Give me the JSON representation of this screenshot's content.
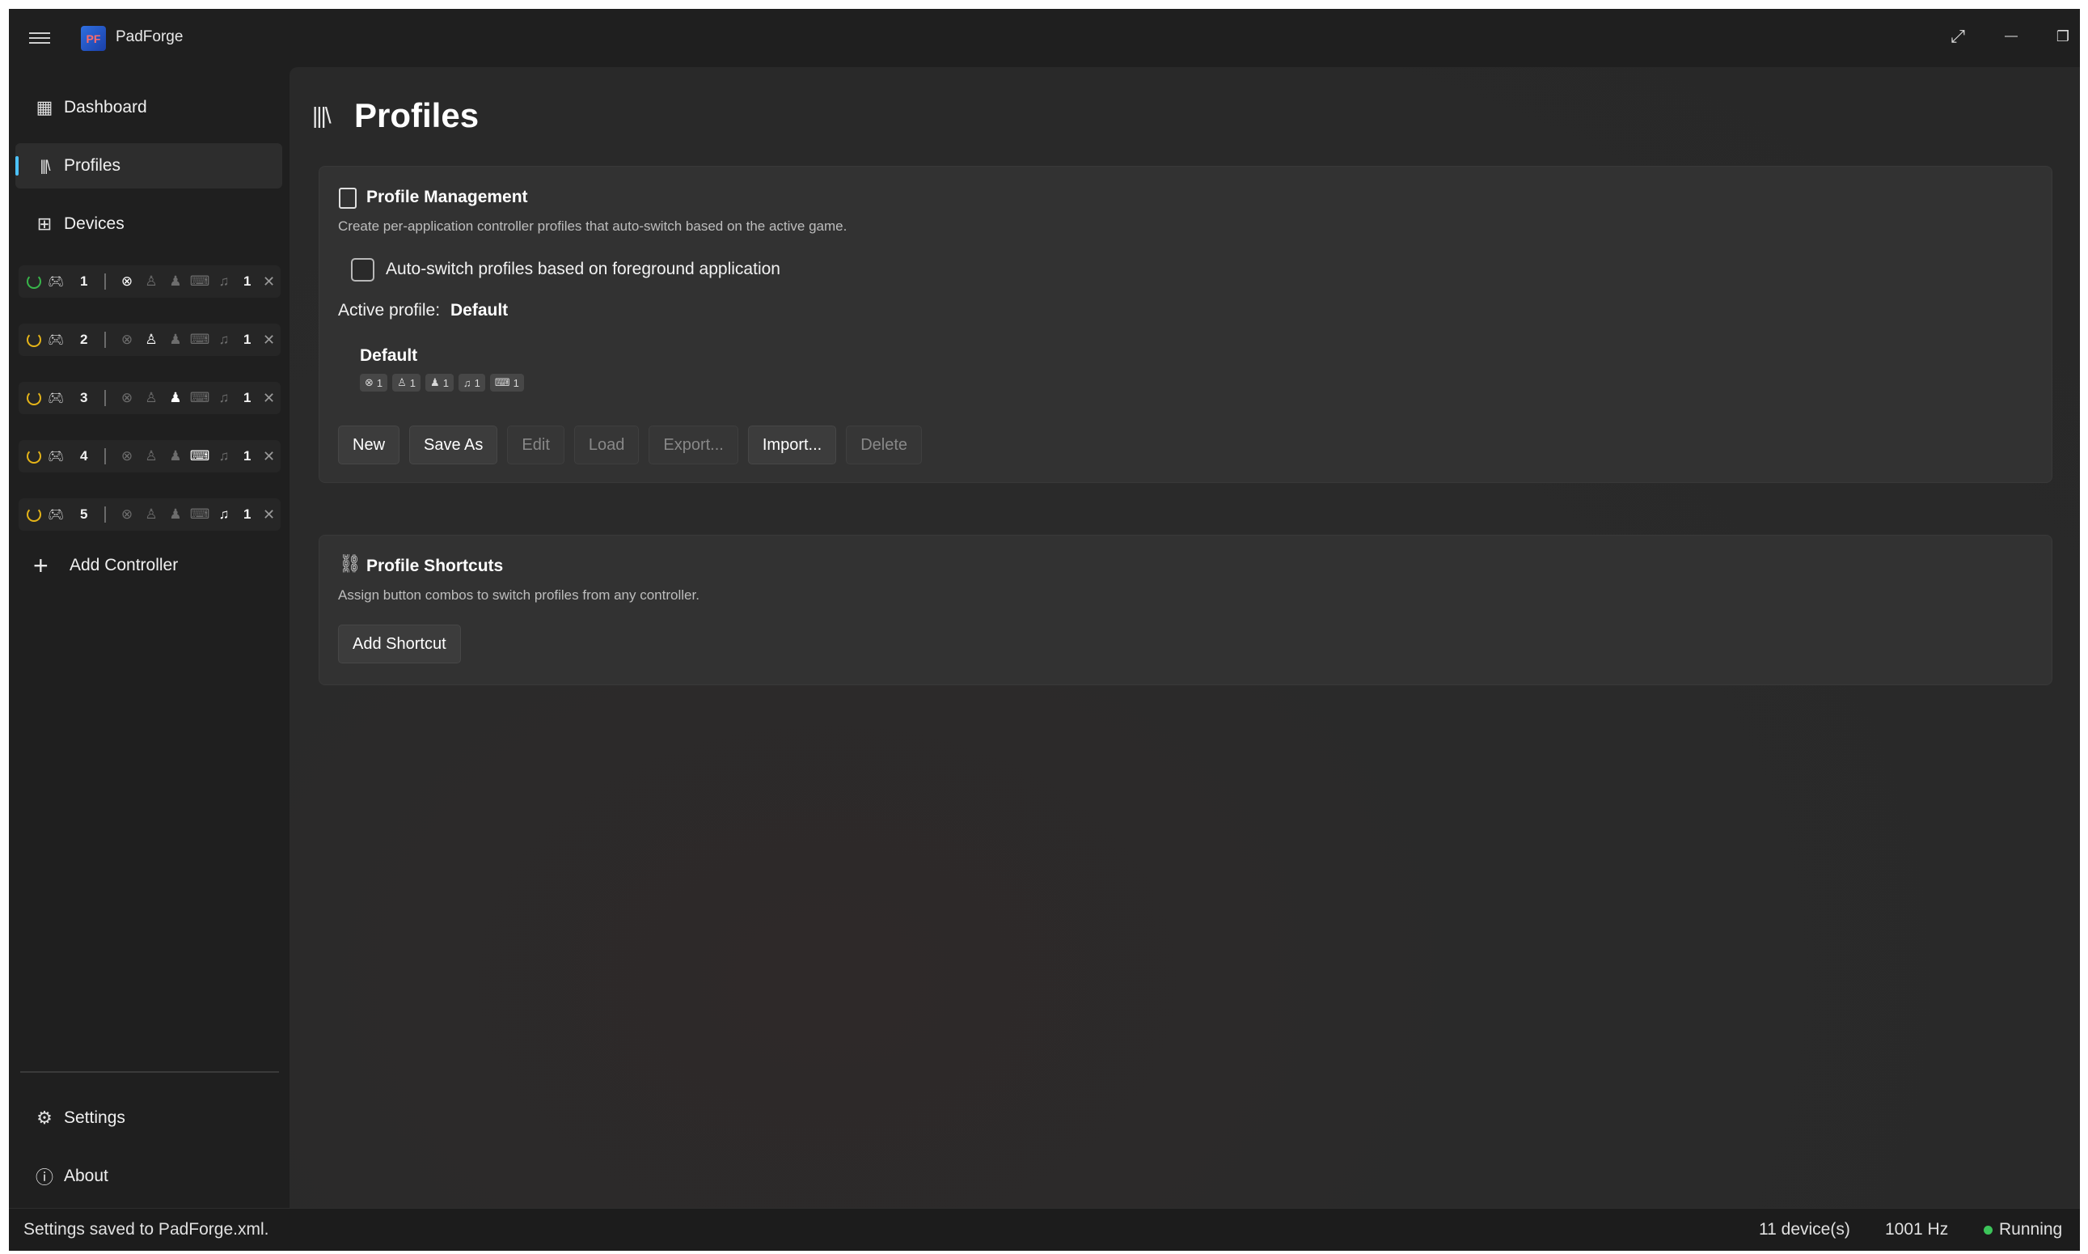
{
  "app": {
    "title": "PadForge",
    "logo_text": "PF"
  },
  "window_controls": {
    "expand": "⤢",
    "minimize": "—",
    "restore": "❐",
    "close": "✕"
  },
  "sidebar": {
    "items": [
      {
        "label": "Dashboard",
        "icon": "dashboard-icon"
      },
      {
        "label": "Profiles",
        "icon": "library-icon",
        "selected": true
      },
      {
        "label": "Devices",
        "icon": "devices-icon"
      }
    ],
    "slots": [
      {
        "number": "1",
        "count": "1",
        "power": "on",
        "active_type": "xbox"
      },
      {
        "number": "2",
        "count": "1",
        "power": "standby",
        "active_type": "playstation"
      },
      {
        "number": "3",
        "count": "1",
        "power": "standby",
        "active_type": "person"
      },
      {
        "number": "4",
        "count": "1",
        "power": "standby",
        "active_type": "keyboard"
      },
      {
        "number": "5",
        "count": "1",
        "power": "standby",
        "active_type": "midi"
      }
    ],
    "add_controller": "Add Controller",
    "footer_items": [
      {
        "label": "Settings",
        "icon": "gear-icon"
      },
      {
        "label": "About",
        "icon": "info-icon"
      }
    ]
  },
  "page": {
    "title": "Profiles"
  },
  "profile_management": {
    "title": "Profile Management",
    "description": "Create per-application controller profiles that auto-switch based on the active game.",
    "auto_switch_label": "Auto-switch profiles based on foreground application",
    "auto_switch_checked": false,
    "active_profile_label": "Active profile:",
    "active_profile_value": "Default",
    "profile": {
      "name": "Default",
      "badges": [
        {
          "icon": "xbox-icon",
          "count": "1"
        },
        {
          "icon": "playstation-icon",
          "count": "1"
        },
        {
          "icon": "person-icon",
          "count": "1"
        },
        {
          "icon": "midi-icon",
          "count": "1"
        },
        {
          "icon": "keyboard-icon",
          "count": "1"
        }
      ]
    },
    "buttons": {
      "new": "New",
      "save_as": "Save As",
      "edit": "Edit",
      "load": "Load",
      "export": "Export...",
      "import": "Import...",
      "delete": "Delete"
    }
  },
  "profile_shortcuts": {
    "title": "Profile Shortcuts",
    "description": "Assign button combos to switch profiles from any controller.",
    "add_button": "Add Shortcut"
  },
  "status_bar": {
    "message": "Settings saved to PadForge.xml.",
    "devices": "11 device(s)",
    "polling": "1001 Hz",
    "state": "Running",
    "state_color": "#3cc45a"
  }
}
